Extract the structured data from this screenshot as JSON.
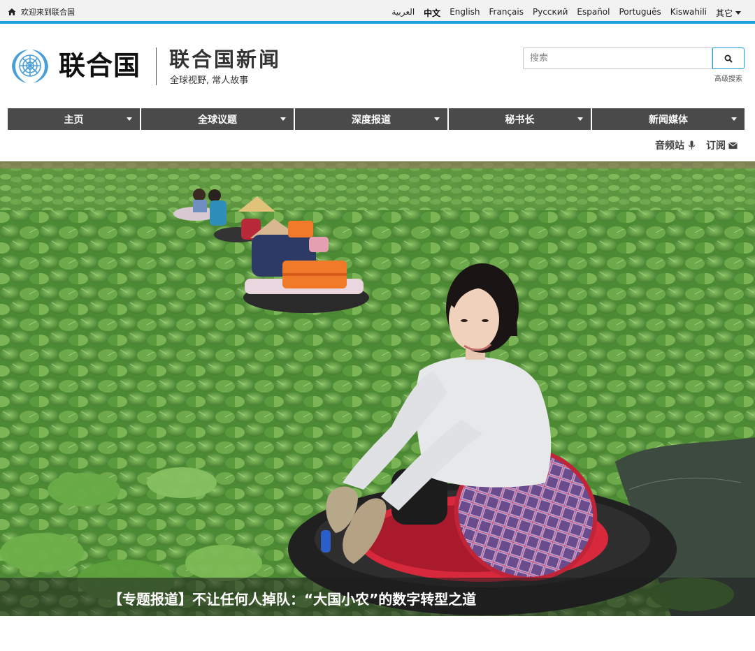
{
  "topbar": {
    "welcome": "欢迎来到联合国",
    "languages": [
      "العربية",
      "中文",
      "English",
      "Français",
      "Русский",
      "Español",
      "Português",
      "Kiswahili",
      "其它"
    ],
    "active_language": "中文"
  },
  "header": {
    "org_name": "联合国",
    "site_title": "联合国新闻",
    "tagline": "全球视野, 常人故事",
    "search_placeholder": "搜索",
    "advanced_search": "高级搜索"
  },
  "nav": {
    "items": [
      {
        "label": "主页"
      },
      {
        "label": "全球议题"
      },
      {
        "label": "深度报道"
      },
      {
        "label": "秘书长"
      },
      {
        "label": "新闻媒体"
      }
    ]
  },
  "subnav": {
    "audio": "音频站",
    "subscribe": "订阅"
  },
  "hero": {
    "caption": "【专题报道】不让任何人掉队：“大国小农”的数字转型之道"
  },
  "colors": {
    "accent": "#1ba1dc",
    "nav_bg": "#4a4a4a",
    "topbar_bg": "#f2f2f2"
  },
  "icons": [
    "home-icon",
    "caret-down-icon",
    "search-icon",
    "microphone-icon",
    "envelope-icon",
    "un-emblem-icon"
  ]
}
